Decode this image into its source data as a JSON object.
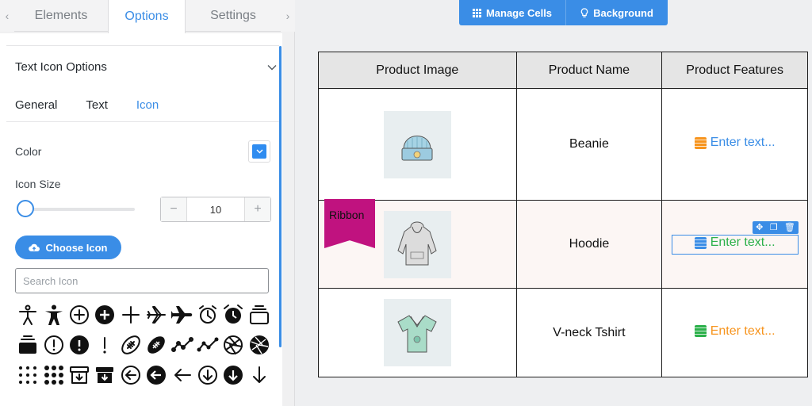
{
  "panel": {
    "tabs": [
      "Elements",
      "Options",
      "Settings"
    ],
    "active_tab": "Options",
    "section_title": "Text Icon Options",
    "subtabs": [
      "General",
      "Text",
      "Icon"
    ],
    "active_subtab": "Icon",
    "color_label": "Color",
    "color_value": "#2f8cf0",
    "icon_size_label": "Icon Size",
    "icon_size_value": "10",
    "choose_icon_label": "Choose Icon",
    "search_placeholder": "Search Icon",
    "icons": [
      "accessibility-outline-icon",
      "accessibility-icon",
      "add-circle-outline-icon",
      "add-circle-icon",
      "add-icon",
      "airplane-outline-icon",
      "airplane-icon",
      "alarm-outline-icon",
      "alarm-icon",
      "albums-outline-icon",
      "albums-icon",
      "alert-circle-outline-icon",
      "alert-circle-icon",
      "alert-icon",
      "american-football-outline-icon",
      "american-football-icon",
      "analytics-outline-icon",
      "analytics-icon",
      "aperture-outline-icon",
      "aperture-icon",
      "apps-outline-icon",
      "apps-icon",
      "archive-outline-icon",
      "archive-icon",
      "arrow-back-circle-outline-icon",
      "arrow-back-circle-icon",
      "arrow-back-icon",
      "arrow-down-circle-outline-icon",
      "arrow-down-circle-icon",
      "arrow-down-icon"
    ]
  },
  "toolbar": {
    "manage_cells": "Manage Cells",
    "background": "Background"
  },
  "table": {
    "headers": [
      "Product Image",
      "Product Name",
      "Product Features"
    ],
    "rows": [
      {
        "name": "Beanie",
        "feature_text": "Enter text...",
        "feature_color": "#f7941d"
      },
      {
        "name": "Hoodie",
        "feature_text": "Enter text...",
        "feature_color": "#2bb04a"
      },
      {
        "name": "V-neck Tshirt",
        "feature_text": "Enter text...",
        "feature_color": "#f7941d"
      }
    ],
    "ribbon": "Ribbon"
  },
  "colors": {
    "accent": "#3a8de6",
    "ribbon": "#c0127f",
    "feature_blue": "#3a8de6",
    "feature_orange": "#f7941d",
    "feature_green": "#2bb04a"
  }
}
